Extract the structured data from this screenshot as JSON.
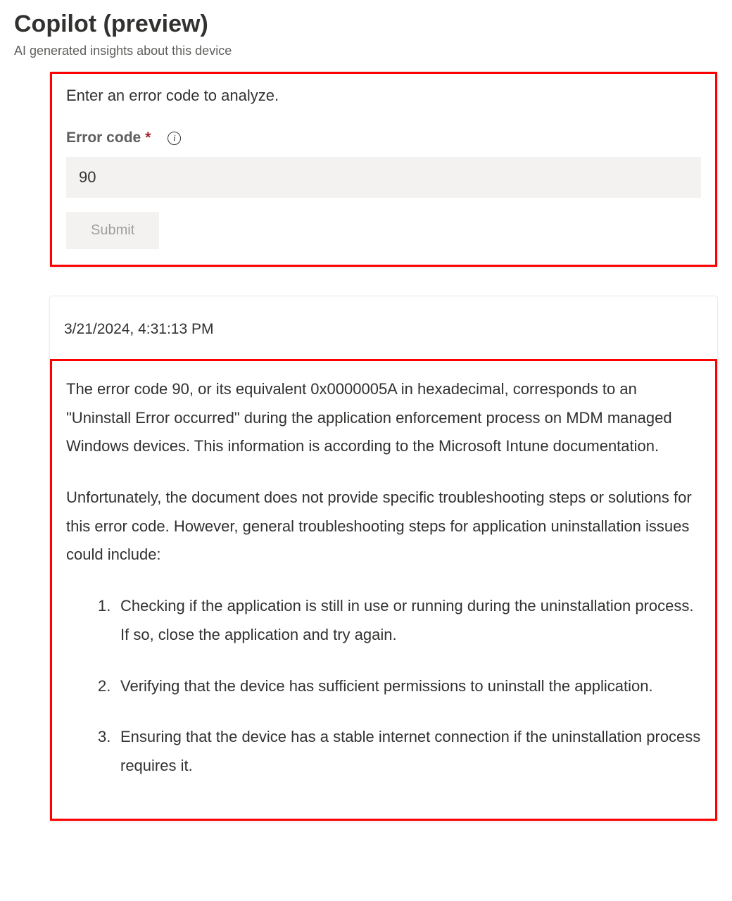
{
  "header": {
    "title": "Copilot (preview)",
    "subtitle": "AI generated insights about this device"
  },
  "input_card": {
    "prompt": "Enter an error code to analyze.",
    "field_label": "Error code",
    "required_mark": "*",
    "info_glyph": "i",
    "input_value": "90",
    "submit_label": "Submit"
  },
  "response_card": {
    "timestamp": "3/21/2024, 4:31:13 PM",
    "paragraph1": "The error code 90, or its equivalent 0x0000005A in hexadecimal, corresponds to an \"Uninstall Error occurred\" during the application enforcement process on MDM managed Windows devices. This information is according to the Microsoft Intune documentation.",
    "paragraph2": "Unfortunately, the document does not provide specific troubleshooting steps or solutions for this error code. However, general troubleshooting steps for application uninstallation issues could include:",
    "list": [
      "Checking if the application is still in use or running during the uninstallation process. If so, close the application and try again.",
      "Verifying that the device has sufficient permissions to uninstall the application.",
      "Ensuring that the device has a stable internet connection if the uninstallation process requires it."
    ]
  }
}
